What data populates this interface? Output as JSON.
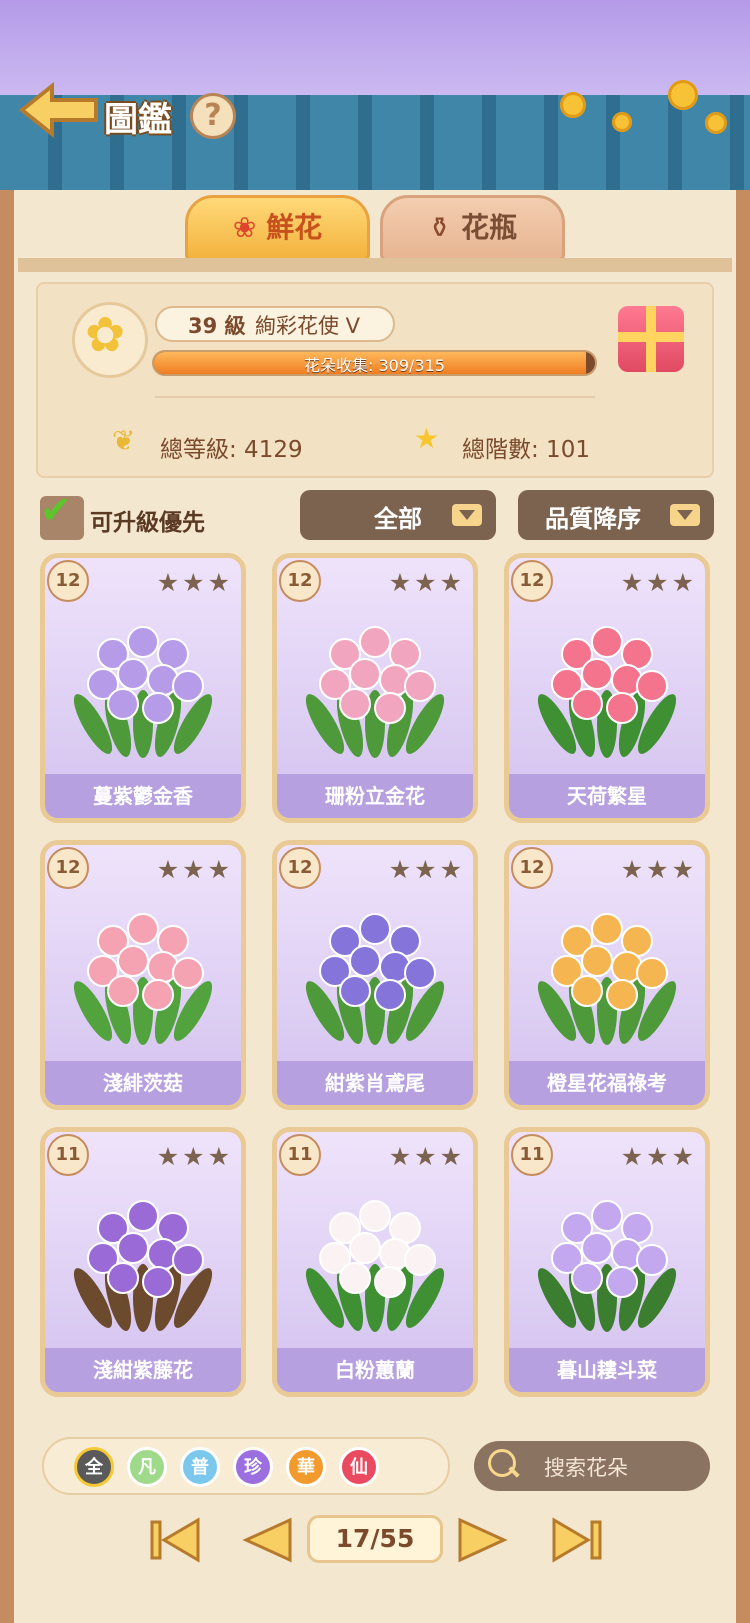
{
  "header": {
    "title": "圖鑑",
    "help_label": "?"
  },
  "tabs": [
    {
      "label": "鮮花",
      "icon": "rose-icon",
      "active": true
    },
    {
      "label": "花瓶",
      "icon": "vase-icon",
      "active": false
    }
  ],
  "profile": {
    "level": "39 級",
    "rank_title": "絢彩花使 V",
    "collection_label": "花朵收集: 309/315",
    "collection_progress": 0.98,
    "total_level_label": "總等級: 4129",
    "total_stage_label": "總階數: 101"
  },
  "filters": {
    "priority_label": "可升級優先",
    "priority_checked": true,
    "category_value": "全部",
    "sort_value": "品質降序"
  },
  "cards": [
    {
      "level": "12",
      "name": "蔓紫鬱金香",
      "stars": 3,
      "art": "purple-tulip"
    },
    {
      "level": "12",
      "name": "珊粉立金花",
      "stars": 3,
      "art": "pink-lachenalia"
    },
    {
      "level": "12",
      "name": "天荷繁星",
      "stars": 3,
      "art": "pink-azalea"
    },
    {
      "level": "12",
      "name": "淺緋茨菇",
      "stars": 3,
      "art": "pink-arrowhead"
    },
    {
      "level": "12",
      "name": "紺紫肖鳶尾",
      "stars": 3,
      "art": "purple-iris"
    },
    {
      "level": "12",
      "name": "橙星花福祿考",
      "stars": 3,
      "art": "orange-phlox"
    },
    {
      "level": "11",
      "name": "淺紺紫藤花",
      "stars": 3,
      "art": "wisteria"
    },
    {
      "level": "11",
      "name": "白粉蕙蘭",
      "stars": 3,
      "art": "white-orchid"
    },
    {
      "level": "11",
      "name": "暮山耬斗菜",
      "stars": 3,
      "art": "columbine"
    }
  ],
  "quality_filters": [
    {
      "label": "全",
      "color": "#5a5a5a"
    },
    {
      "label": "凡",
      "color": "#9fd98a"
    },
    {
      "label": "普",
      "color": "#7cc7ec"
    },
    {
      "label": "珍",
      "color": "#9b6fe0"
    },
    {
      "label": "華",
      "color": "#f39a2c"
    },
    {
      "label": "仙",
      "color": "#e94a5f"
    }
  ],
  "search": {
    "placeholder": "搜索花朵"
  },
  "pagination": {
    "current": "17/55"
  },
  "colors": {
    "accent": "#f3b33d",
    "card_bg": "#e3d5f6",
    "brown": "#7b4a2c"
  }
}
